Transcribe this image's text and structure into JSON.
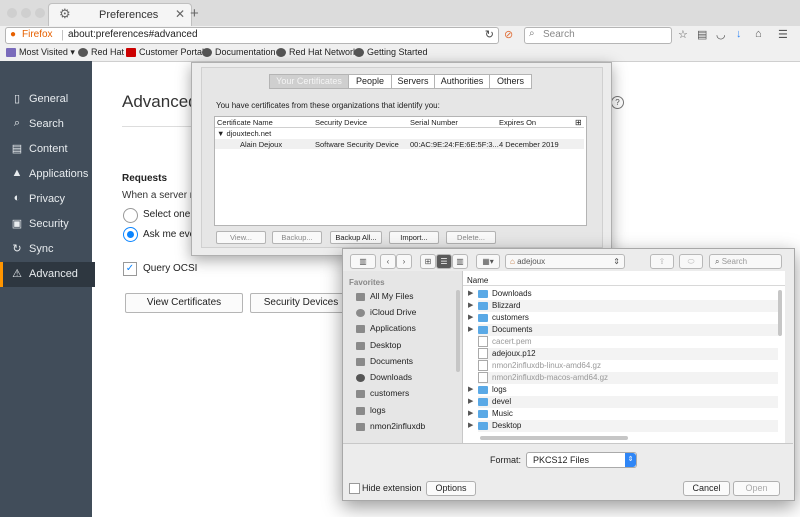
{
  "tab": {
    "title": "Preferences",
    "close": "✕",
    "new": "+"
  },
  "nav": {
    "brand": "Firefox",
    "url": "about:preferences#advanced",
    "search_placeholder": "Search"
  },
  "bookmarks": [
    "Most Visited ▾",
    "Red Hat",
    "Customer Portal",
    "Documentation",
    "Red Hat Network",
    "Getting Started"
  ],
  "sidebar": {
    "items": [
      {
        "label": "General",
        "icon": "phone-icon"
      },
      {
        "label": "Search",
        "icon": "search-icon"
      },
      {
        "label": "Content",
        "icon": "document-icon"
      },
      {
        "label": "Applications",
        "icon": "rocket-icon"
      },
      {
        "label": "Privacy",
        "icon": "mask-icon"
      },
      {
        "label": "Security",
        "icon": "lock-icon"
      },
      {
        "label": "Sync",
        "icon": "sync-icon"
      },
      {
        "label": "Advanced",
        "icon": "wizard-icon"
      }
    ],
    "active": "Advanced"
  },
  "main": {
    "heading": "Advanced",
    "help": "?",
    "requests_title": "Requests",
    "requests_text": "When a server re",
    "radio_1": "Select one a",
    "radio_2": "Ask me eve",
    "ocsp": "Query OCSI",
    "view_certs": "View Certificates",
    "security_devices": "Security Devices"
  },
  "cert_dialog": {
    "tabs": [
      "Your Certificates",
      "People",
      "Servers",
      "Authorities",
      "Others"
    ],
    "selected_tab": "Your Certificates",
    "info": "You have certificates from these organizations that identify you:",
    "columns": [
      "Certificate Name",
      "Security Device",
      "Serial Number",
      "Expires On"
    ],
    "group": "djouxtech.net",
    "row": {
      "name": "Alain Dejoux",
      "device": "Software Security Device",
      "serial": "00:AC:9E:24:FE:6E:5F:3...",
      "expires": "4 December 2019"
    },
    "buttons": [
      "View...",
      "Backup...",
      "Backup All...",
      "Import...",
      "Delete..."
    ]
  },
  "file_dialog": {
    "location": "adejoux",
    "search_placeholder": "Search",
    "favorites_title": "Favorites",
    "favorites": [
      "All My Files",
      "iCloud Drive",
      "Applications",
      "Desktop",
      "Documents",
      "Downloads",
      "customers",
      "logs",
      "nmon2influxdb"
    ],
    "list_header": "Name",
    "files": [
      {
        "name": "Downloads",
        "type": "folder"
      },
      {
        "name": "Blizzard",
        "type": "folder"
      },
      {
        "name": "customers",
        "type": "folder"
      },
      {
        "name": "Documents",
        "type": "folder"
      },
      {
        "name": "cacert.pem",
        "type": "file-dim"
      },
      {
        "name": "adejoux.p12",
        "type": "file"
      },
      {
        "name": "nmon2influxdb-linux-amd64.gz",
        "type": "file-dim"
      },
      {
        "name": "nmon2influxdb-macos-amd64.gz",
        "type": "file-dim"
      },
      {
        "name": "logs",
        "type": "folder"
      },
      {
        "name": "devel",
        "type": "folder"
      },
      {
        "name": "Music",
        "type": "folder"
      },
      {
        "name": "Desktop",
        "type": "folder"
      }
    ],
    "format_label": "Format:",
    "format_value": "PKCS12 Files",
    "hide_extension": "Hide extension",
    "options": "Options",
    "cancel": "Cancel",
    "open": "Open"
  },
  "colors": {
    "sidebar": "#414d5a",
    "accent": "#ff9500",
    "blue": "#0a84ff"
  }
}
